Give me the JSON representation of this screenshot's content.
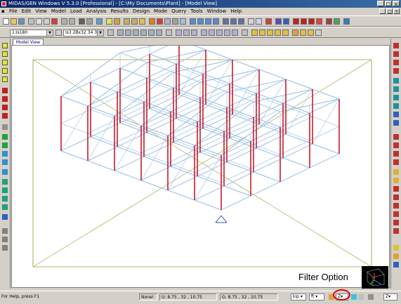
{
  "window": {
    "title": "MIDAS/GEN Windows V 5.3.0 [Professional] - [C:\\My Documents\\Plant] - [Model View]",
    "buttons": [
      "_",
      "□",
      "×"
    ]
  },
  "menu": {
    "items": [
      "File",
      "Edit",
      "View",
      "Model",
      "Load",
      "Analysis",
      "Results",
      "Design",
      "Mode",
      "Query",
      "Tools",
      "Window",
      "Help"
    ],
    "mdi_buttons": [
      "_",
      "□",
      "×"
    ]
  },
  "toolbar": {
    "section_combo": "1:Is180",
    "material_combo": "Is3 2Bx32 34 35 3"
  },
  "tab": {
    "label": "Model View"
  },
  "annotation": {
    "label": "Filter Option"
  },
  "status": {
    "help": "For Help, press F1",
    "none": "None!",
    "u_coord": "U: 8.75 , 32 , 10.75",
    "g_coord": "G: 8.75 , 32 , 10.75",
    "unit_force": "kip",
    "unit_length": "ft",
    "filter_value": "Z",
    "right_combo": "Z"
  },
  "colors": {
    "title_start": "#0a246a",
    "title_end": "#3a6ea5",
    "member": "#a6c8e8",
    "column": "#cc1a2a",
    "guide": "#9a9a30",
    "highlight": "#e00000"
  }
}
